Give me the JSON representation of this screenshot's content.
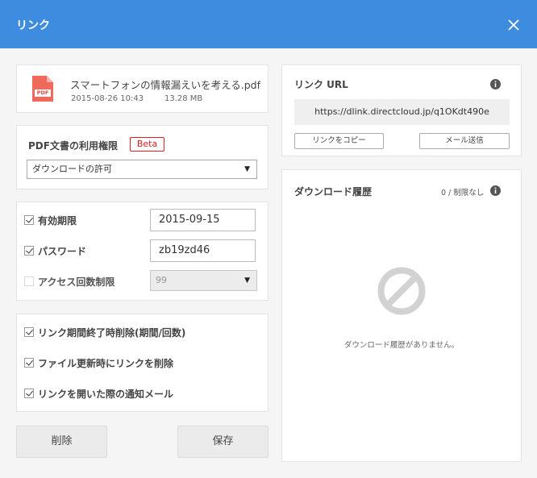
{
  "window": {
    "title": "リンク"
  },
  "file": {
    "name": "スマートフォンの情報漏えいを考える.pdf",
    "date": "2015-08-26 10:43",
    "size": "13.28 MB",
    "icon_label": "PDF"
  },
  "pdf_permission": {
    "title": "PDF文書の利用権限",
    "badge": "Beta",
    "selected": "ダウンロードの許可"
  },
  "settings": {
    "expiry": {
      "label": "有効期限",
      "checked": true,
      "value": "2015-09-15"
    },
    "password": {
      "label": "パスワード",
      "checked": true,
      "value": "zb19zd46"
    },
    "access_limit": {
      "label": "アクセス回数制限",
      "checked": false,
      "value": "99"
    }
  },
  "options": [
    {
      "label": "リンク期間終了時削除(期間/回数)",
      "checked": true
    },
    {
      "label": "ファイル更新時にリンクを削除",
      "checked": true
    },
    {
      "label": "リンクを開いた際の通知メール",
      "checked": true
    }
  ],
  "buttons": {
    "delete": "削除",
    "save": "保存"
  },
  "link_url": {
    "title": "リンク URL",
    "url": "https://dlink.directcloud.jp/q1OKdt490e",
    "copy_button": "リンクをコピー",
    "mail_button": "メール送信"
  },
  "download_history": {
    "title": "ダウンロード履歴",
    "count": "0 / 制限なし",
    "empty_message": "ダウンロード履歴がありません。"
  },
  "colors": {
    "header": "#3e8ce0",
    "pdf_icon": "#f06a5c",
    "badge": "#e02020"
  }
}
